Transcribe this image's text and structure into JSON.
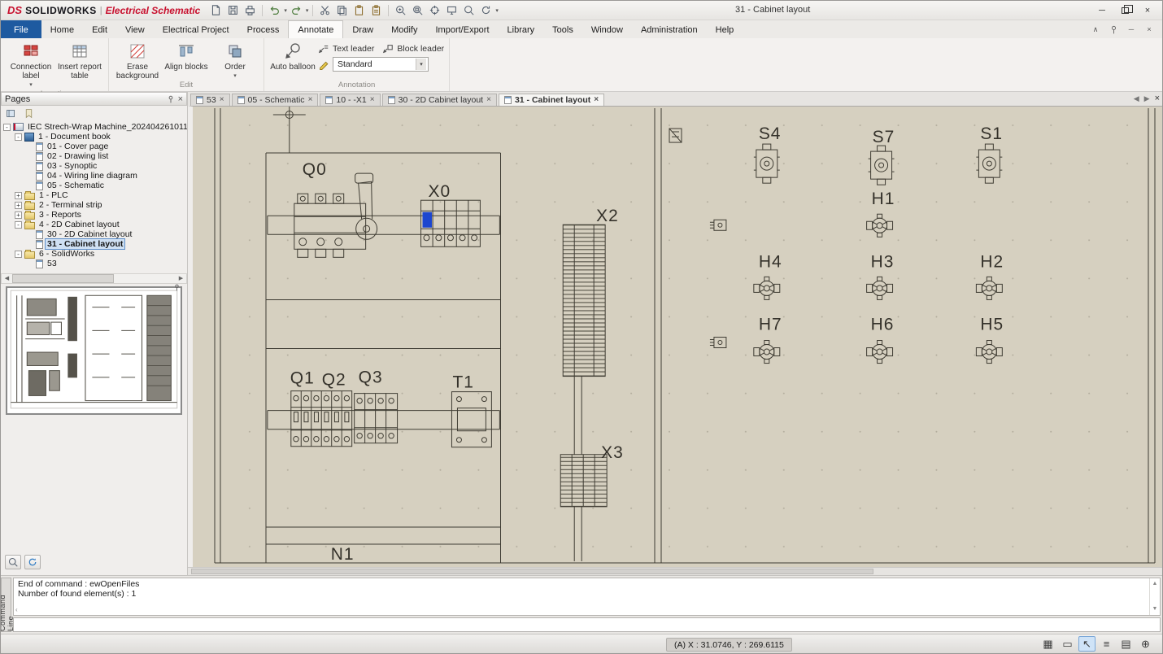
{
  "titlebar": {
    "logo": "DS",
    "app_name": "SOLIDWORKS",
    "separator": "|",
    "edition": "Electrical Schematic",
    "document_title": "31 - Cabinet layout"
  },
  "menubar": {
    "active_tab": "Annotate",
    "tabs": [
      {
        "label": "File"
      },
      {
        "label": "Home"
      },
      {
        "label": "Edit"
      },
      {
        "label": "View"
      },
      {
        "label": "Electrical Project"
      },
      {
        "label": "Process"
      },
      {
        "label": "Annotate"
      },
      {
        "label": "Draw"
      },
      {
        "label": "Modify"
      },
      {
        "label": "Import/Export"
      },
      {
        "label": "Library"
      },
      {
        "label": "Tools"
      },
      {
        "label": "Window"
      },
      {
        "label": "Administration"
      },
      {
        "label": "Help"
      }
    ]
  },
  "ribbon": {
    "insertion": {
      "group_label": "Insertion",
      "connection_label": "Connection label",
      "insert_report_table": "Insert report table"
    },
    "edit": {
      "group_label": "Edit",
      "erase_background": "Erase background",
      "align_blocks": "Align blocks",
      "order": "Order"
    },
    "annotation": {
      "group_label": "Annotation",
      "auto_balloon": "Auto balloon",
      "text_leader": "Text leader",
      "block_leader": "Block leader",
      "style_value": "Standard"
    }
  },
  "pages_panel": {
    "title": "Pages",
    "tree": [
      {
        "label": "IEC Strech-Wrap Machine_2024042610112",
        "level": 0,
        "toggle": "-",
        "icon": "project"
      },
      {
        "label": "1 - Document book",
        "level": 1,
        "toggle": "-",
        "icon": "book"
      },
      {
        "label": "01 - Cover page",
        "level": 2,
        "icon": "page"
      },
      {
        "label": "02 - Drawing list",
        "level": 2,
        "icon": "page"
      },
      {
        "label": "03 - Synoptic",
        "level": 2,
        "icon": "page"
      },
      {
        "label": "04 - Wiring line diagram",
        "level": 2,
        "icon": "page"
      },
      {
        "label": "05 - Schematic",
        "level": 2,
        "icon": "page"
      },
      {
        "label": "1 - PLC",
        "level": 1,
        "toggle": "+",
        "icon": "folder"
      },
      {
        "label": "2 - Terminal strip",
        "level": 1,
        "toggle": "+",
        "icon": "folder"
      },
      {
        "label": "3 - Reports",
        "level": 1,
        "toggle": "+",
        "icon": "folder"
      },
      {
        "label": "4 - 2D Cabinet layout",
        "level": 1,
        "toggle": "-",
        "icon": "folder"
      },
      {
        "label": "30 - 2D Cabinet layout",
        "level": 2,
        "icon": "page"
      },
      {
        "label": "31 - Cabinet layout",
        "level": 2,
        "icon": "page",
        "selected": true
      },
      {
        "label": "6 - SolidWorks",
        "level": 1,
        "toggle": "-",
        "icon": "folder"
      },
      {
        "label": "53",
        "level": 2,
        "icon": "page"
      }
    ]
  },
  "document_tabs": {
    "active_tab": "31 - Cabinet layout",
    "tabs": [
      {
        "label": "53"
      },
      {
        "label": "05 - Schematic"
      },
      {
        "label": "10 - -X1"
      },
      {
        "label": "30 - 2D Cabinet layout"
      },
      {
        "label": "31 - Cabinet layout"
      }
    ]
  },
  "drawing": {
    "canvas_color": "#d6d0c0",
    "line_color": "#3f3c33",
    "selection_color": "#1c46cf",
    "component_labels": {
      "q0": "Q0",
      "x0": "X0",
      "x2": "X2",
      "q1": "Q1",
      "q2": "Q2",
      "q3": "Q3",
      "t1": "T1",
      "x3": "X3",
      "n1": "N1",
      "s4": "S4",
      "s7": "S7",
      "s1": "S1",
      "h1": "H1",
      "h4": "H4",
      "h3": "H3",
      "h2": "H2",
      "h7": "H7",
      "h6": "H6",
      "h5": "H5"
    }
  },
  "command_panel": {
    "tab_label": "Command Line",
    "lines": [
      "End of command : ewOpenFiles",
      "Number of found element(s) : 1"
    ]
  },
  "statusbar": {
    "coordinates": "(A) X : 31.0746, Y : 269.6115"
  },
  "icons": {
    "close": "×",
    "caret_down": "▾",
    "chevron_up": "∧",
    "minimize": "─",
    "arrow_left": "◀",
    "arrow_right": "▶",
    "arrow_up": "▲",
    "arrow_down": "▼",
    "back_arrow": "‹",
    "grid": "▦",
    "ortho": "▭",
    "pointer": "↖",
    "lines": "≡",
    "sheet": "▤",
    "world": "⊕"
  }
}
